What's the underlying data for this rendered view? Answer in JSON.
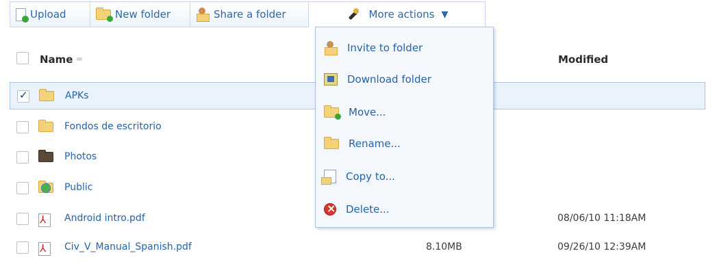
{
  "toolbar": {
    "upload_label": "Upload",
    "new_folder_label": "New folder",
    "share_label": "Share a folder",
    "more_actions_label": "More actions"
  },
  "list_header": {
    "name_label": "Name",
    "sort_indicator": "=",
    "modified_label": "Modified"
  },
  "files": [
    {
      "name": "APKs",
      "size": "",
      "modified": "",
      "icon": "folder-icon",
      "selected": true
    },
    {
      "name": "Fondos de escritorio",
      "size": "",
      "modified": "",
      "icon": "folder-icon",
      "selected": false
    },
    {
      "name": "Photos",
      "size": "",
      "modified": "",
      "icon": "photos-folder-icon",
      "selected": false
    },
    {
      "name": "Public",
      "size": "",
      "modified": "",
      "icon": "public-folder-icon",
      "selected": false
    },
    {
      "name": "Android intro.pdf",
      "size": "",
      "modified": "08/06/10 11:18AM",
      "icon": "pdf-icon",
      "selected": false
    },
    {
      "name": "Civ_V_Manual_Spanish.pdf",
      "size": "8.10MB",
      "modified": "09/26/10 12:39AM",
      "icon": "pdf-icon",
      "selected": false
    }
  ],
  "menu": {
    "items": [
      {
        "label": "Invite to folder",
        "icon": "invite-icon"
      },
      {
        "label": "Download folder",
        "icon": "download-icon"
      },
      {
        "label": "Move...",
        "icon": "move-icon"
      },
      {
        "label": "Rename...",
        "icon": "rename-icon"
      },
      {
        "label": "Copy to...",
        "icon": "copy-icon"
      },
      {
        "label": "Delete...",
        "icon": "delete-icon"
      }
    ]
  },
  "colors": {
    "link": "#2463ad",
    "selected_row": "#eaf2fc",
    "menu_bg": "#f4f8fd"
  }
}
